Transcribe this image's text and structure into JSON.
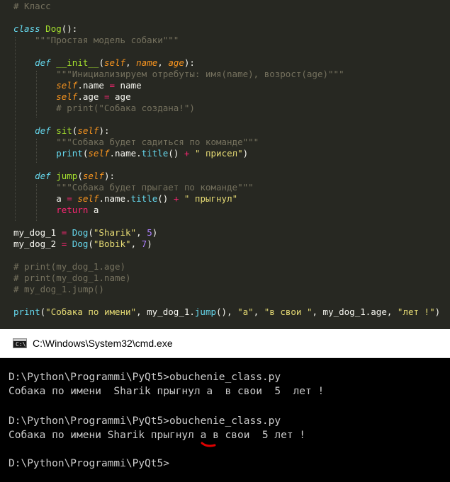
{
  "editor": {
    "lines": [
      [
        {
          "t": "# Класс",
          "c": "cmt"
        }
      ],
      [],
      [
        {
          "t": "class",
          "c": "kw"
        },
        {
          "t": " ",
          "c": "txt"
        },
        {
          "t": "Dog",
          "c": "cls"
        },
        {
          "t": "():",
          "c": "txt"
        }
      ],
      [
        {
          "t": "    \"\"\"Простая модель собаки\"\"\"",
          "c": "doc"
        }
      ],
      [],
      [
        {
          "t": "    ",
          "c": "txt"
        },
        {
          "t": "def",
          "c": "kw"
        },
        {
          "t": " ",
          "c": "txt"
        },
        {
          "t": "__init__",
          "c": "fn"
        },
        {
          "t": "(",
          "c": "txt"
        },
        {
          "t": "self",
          "c": "param"
        },
        {
          "t": ", ",
          "c": "txt"
        },
        {
          "t": "name",
          "c": "param"
        },
        {
          "t": ", ",
          "c": "txt"
        },
        {
          "t": "age",
          "c": "param"
        },
        {
          "t": "):",
          "c": "txt"
        }
      ],
      [
        {
          "t": "        \"\"\"Инициализируем отребуты: имя(name), возрост(age)\"\"\"",
          "c": "doc"
        }
      ],
      [
        {
          "t": "        ",
          "c": "txt"
        },
        {
          "t": "self",
          "c": "self"
        },
        {
          "t": ".name ",
          "c": "txt"
        },
        {
          "t": "=",
          "c": "op"
        },
        {
          "t": " name",
          "c": "txt"
        }
      ],
      [
        {
          "t": "        ",
          "c": "txt"
        },
        {
          "t": "self",
          "c": "self"
        },
        {
          "t": ".age ",
          "c": "txt"
        },
        {
          "t": "=",
          "c": "op"
        },
        {
          "t": " age",
          "c": "txt"
        }
      ],
      [
        {
          "t": "        # print(\"Собака создана!\")",
          "c": "cmt"
        }
      ],
      [],
      [
        {
          "t": "    ",
          "c": "txt"
        },
        {
          "t": "def",
          "c": "kw"
        },
        {
          "t": " ",
          "c": "txt"
        },
        {
          "t": "sit",
          "c": "fn"
        },
        {
          "t": "(",
          "c": "txt"
        },
        {
          "t": "self",
          "c": "param"
        },
        {
          "t": "):",
          "c": "txt"
        }
      ],
      [
        {
          "t": "        \"\"\"Собака будет садиться по команде\"\"\"",
          "c": "doc"
        }
      ],
      [
        {
          "t": "        ",
          "c": "txt"
        },
        {
          "t": "print",
          "c": "bi"
        },
        {
          "t": "(",
          "c": "txt"
        },
        {
          "t": "self",
          "c": "self"
        },
        {
          "t": ".name.",
          "c": "txt"
        },
        {
          "t": "title",
          "c": "bi"
        },
        {
          "t": "() ",
          "c": "txt"
        },
        {
          "t": "+",
          "c": "op"
        },
        {
          "t": " ",
          "c": "txt"
        },
        {
          "t": "\" присел\"",
          "c": "str"
        },
        {
          "t": ")",
          "c": "txt"
        }
      ],
      [],
      [
        {
          "t": "    ",
          "c": "txt"
        },
        {
          "t": "def",
          "c": "kw"
        },
        {
          "t": " ",
          "c": "txt"
        },
        {
          "t": "jump",
          "c": "fn"
        },
        {
          "t": "(",
          "c": "txt"
        },
        {
          "t": "self",
          "c": "param"
        },
        {
          "t": "):",
          "c": "txt"
        }
      ],
      [
        {
          "t": "        \"\"\"Собака будет прыгает по команде\"\"\"",
          "c": "doc"
        }
      ],
      [
        {
          "t": "        a ",
          "c": "txt"
        },
        {
          "t": "=",
          "c": "op"
        },
        {
          "t": " ",
          "c": "txt"
        },
        {
          "t": "self",
          "c": "self"
        },
        {
          "t": ".name.",
          "c": "txt"
        },
        {
          "t": "title",
          "c": "bi"
        },
        {
          "t": "() ",
          "c": "txt"
        },
        {
          "t": "+",
          "c": "op"
        },
        {
          "t": " ",
          "c": "txt"
        },
        {
          "t": "\" прыгнул\"",
          "c": "str"
        }
      ],
      [
        {
          "t": "        ",
          "c": "txt"
        },
        {
          "t": "return",
          "c": "ctrl"
        },
        {
          "t": " a",
          "c": "txt"
        }
      ],
      [],
      [
        {
          "t": "my_dog_1 ",
          "c": "txt"
        },
        {
          "t": "=",
          "c": "op"
        },
        {
          "t": " ",
          "c": "txt"
        },
        {
          "t": "Dog",
          "c": "bi"
        },
        {
          "t": "(",
          "c": "txt"
        },
        {
          "t": "\"Sharik\"",
          "c": "str"
        },
        {
          "t": ", ",
          "c": "txt"
        },
        {
          "t": "5",
          "c": "num"
        },
        {
          "t": ")",
          "c": "txt"
        }
      ],
      [
        {
          "t": "my_dog_2 ",
          "c": "txt"
        },
        {
          "t": "=",
          "c": "op"
        },
        {
          "t": " ",
          "c": "txt"
        },
        {
          "t": "Dog",
          "c": "bi"
        },
        {
          "t": "(",
          "c": "txt"
        },
        {
          "t": "\"Bobik\"",
          "c": "str"
        },
        {
          "t": ", ",
          "c": "txt"
        },
        {
          "t": "7",
          "c": "num"
        },
        {
          "t": ")",
          "c": "txt"
        }
      ],
      [],
      [
        {
          "t": "# print(my_dog_1.age)",
          "c": "cmt"
        }
      ],
      [
        {
          "t": "# print(my_dog_1.name)",
          "c": "cmt"
        }
      ],
      [
        {
          "t": "# my_dog_1.jump()",
          "c": "cmt"
        }
      ],
      [],
      [
        {
          "t": "print",
          "c": "bi"
        },
        {
          "t": "(",
          "c": "txt"
        },
        {
          "t": "\"Собака по имени\"",
          "c": "str"
        },
        {
          "t": ", my_dog_1.",
          "c": "txt"
        },
        {
          "t": "jump",
          "c": "bi"
        },
        {
          "t": "(), ",
          "c": "txt"
        },
        {
          "t": "\"a\"",
          "c": "str"
        },
        {
          "t": ", ",
          "c": "txt"
        },
        {
          "t": "\"в свои \"",
          "c": "str"
        },
        {
          "t": ", my_dog_1.age, ",
          "c": "txt"
        },
        {
          "t": "\"лет !\"",
          "c": "str"
        },
        {
          "t": ")",
          "c": "txt"
        }
      ]
    ]
  },
  "cmd": {
    "icon": "console-window-icon",
    "title": "C:\\Windows\\System32\\cmd.exe",
    "output": [
      "D:\\Python\\Programmi\\PyQt5>obuchenie_class.py",
      "Собака по имени  Sharik прыгнул a  в свои  5  лет !",
      "",
      "D:\\Python\\Programmi\\PyQt5>obuchenie_class.py",
      "Собака по имени Sharik прыгнул a в свои  5 лет !",
      "",
      "D:\\Python\\Programmi\\PyQt5>"
    ]
  },
  "colors": {
    "editor_bg": "#272822",
    "keyword": "#66d9ef",
    "string": "#e6db74",
    "comment": "#75715e",
    "number": "#ae81ff",
    "operator": "#f92672",
    "param": "#fd971f",
    "function": "#a6e22e",
    "annotation_mark": "#e00000"
  }
}
